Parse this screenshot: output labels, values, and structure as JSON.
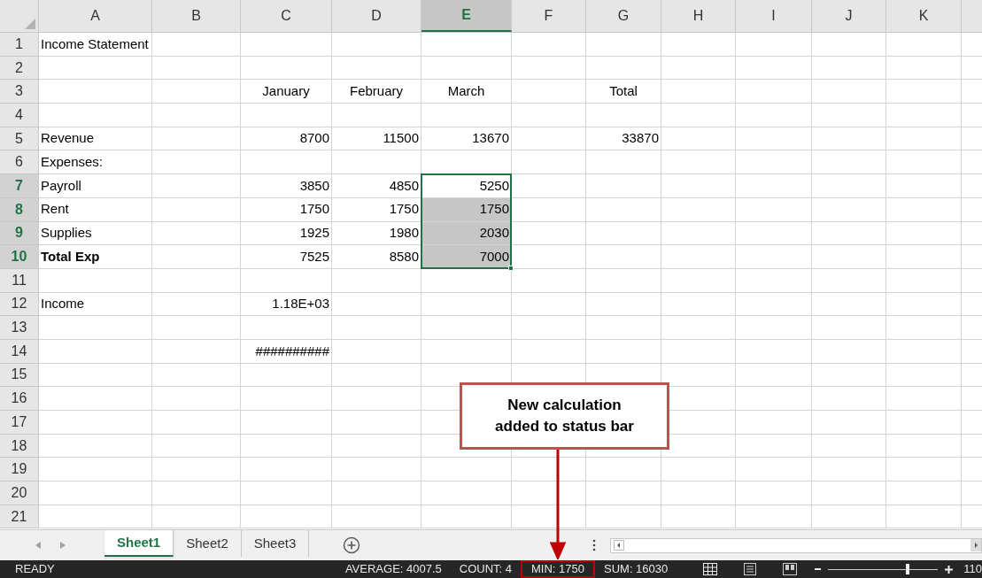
{
  "columns": [
    {
      "label": "A",
      "selected": false
    },
    {
      "label": "B",
      "selected": false
    },
    {
      "label": "C",
      "selected": false
    },
    {
      "label": "D",
      "selected": false
    },
    {
      "label": "E",
      "selected": true
    },
    {
      "label": "F",
      "selected": false
    },
    {
      "label": "G",
      "selected": false
    },
    {
      "label": "H",
      "selected": false
    },
    {
      "label": "I",
      "selected": false
    },
    {
      "label": "J",
      "selected": false
    },
    {
      "label": "K",
      "selected": false
    }
  ],
  "rows": [
    {
      "number": "1",
      "selected": false,
      "cells": [
        {
          "text": "Income Statement",
          "kind": "title",
          "bold": false
        }
      ]
    },
    {
      "number": "2",
      "selected": false,
      "cells": []
    },
    {
      "number": "3",
      "selected": false,
      "cells": [
        null,
        null,
        {
          "text": "January",
          "kind": "heading",
          "bold": false
        },
        {
          "text": "February",
          "kind": "heading",
          "bold": false
        },
        {
          "text": "March",
          "kind": "heading",
          "bold": false
        },
        null,
        {
          "text": "Total",
          "kind": "heading",
          "bold": false
        }
      ]
    },
    {
      "number": "4",
      "selected": false,
      "cells": []
    },
    {
      "number": "5",
      "selected": false,
      "cells": [
        {
          "text": "Revenue",
          "kind": "text",
          "bold": false
        },
        null,
        {
          "text": "8700",
          "kind": "number",
          "bold": false
        },
        {
          "text": "11500",
          "kind": "number",
          "bold": false
        },
        {
          "text": "13670",
          "kind": "number",
          "bold": false
        },
        null,
        {
          "text": "33870",
          "kind": "number",
          "bold": false
        }
      ]
    },
    {
      "number": "6",
      "selected": false,
      "cells": [
        {
          "text": "Expenses:",
          "kind": "text",
          "bold": false
        }
      ]
    },
    {
      "number": "7",
      "selected": true,
      "cells": [
        {
          "text": "Payroll",
          "kind": "text",
          "bold": false
        },
        null,
        {
          "text": "3850",
          "kind": "number",
          "bold": false
        },
        {
          "text": "4850",
          "kind": "number",
          "bold": false
        },
        {
          "text": "5250",
          "kind": "number",
          "bold": false
        }
      ]
    },
    {
      "number": "8",
      "selected": true,
      "cells": [
        {
          "text": "Rent",
          "kind": "text",
          "bold": false
        },
        null,
        {
          "text": "1750",
          "kind": "number",
          "bold": false
        },
        {
          "text": "1750",
          "kind": "number",
          "bold": false
        },
        {
          "text": "1750",
          "kind": "number",
          "bold": false
        }
      ]
    },
    {
      "number": "9",
      "selected": true,
      "cells": [
        {
          "text": "Supplies",
          "kind": "text",
          "bold": false
        },
        null,
        {
          "text": "1925",
          "kind": "number",
          "bold": false
        },
        {
          "text": "1980",
          "kind": "number",
          "bold": false
        },
        {
          "text": "2030",
          "kind": "number",
          "bold": false
        }
      ]
    },
    {
      "number": "10",
      "selected": true,
      "cells": [
        {
          "text": "Total Exp",
          "kind": "text",
          "bold": true
        },
        null,
        {
          "text": "7525",
          "kind": "number",
          "bold": false
        },
        {
          "text": "8580",
          "kind": "number",
          "bold": false
        },
        {
          "text": "7000",
          "kind": "number",
          "bold": false
        }
      ]
    },
    {
      "number": "11",
      "selected": false,
      "cells": []
    },
    {
      "number": "12",
      "selected": false,
      "cells": [
        {
          "text": "Income",
          "kind": "text",
          "bold": false
        },
        null,
        {
          "text": "1.18E+03",
          "kind": "number",
          "bold": false
        }
      ]
    },
    {
      "number": "13",
      "selected": false,
      "cells": []
    },
    {
      "number": "14",
      "selected": false,
      "cells": [
        null,
        null,
        {
          "text": "##########",
          "kind": "number",
          "bold": false
        }
      ]
    },
    {
      "number": "15",
      "selected": false,
      "cells": []
    },
    {
      "number": "16",
      "selected": false,
      "cells": []
    },
    {
      "number": "17",
      "selected": false,
      "cells": []
    },
    {
      "number": "18",
      "selected": false,
      "cells": []
    },
    {
      "number": "19",
      "selected": false,
      "cells": []
    },
    {
      "number": "20",
      "selected": false,
      "cells": []
    },
    {
      "number": "21",
      "selected": false,
      "cells": []
    }
  ],
  "sheet_tabs": [
    {
      "label": "Sheet1",
      "selected": true
    },
    {
      "label": "Sheet2",
      "selected": false
    },
    {
      "label": "Sheet3",
      "selected": false
    }
  ],
  "status_bar": {
    "mode": "READY",
    "stats": [
      {
        "text": "AVERAGE: 4007.5",
        "highlighted": false
      },
      {
        "text": "COUNT: 4",
        "highlighted": false
      },
      {
        "text": "MIN: 1750",
        "highlighted": true
      },
      {
        "text": "SUM: 16030",
        "highlighted": false
      }
    ],
    "zoom": {
      "level": 0.72,
      "text": "110"
    }
  },
  "callout": {
    "text": "New calculation added to status bar"
  }
}
